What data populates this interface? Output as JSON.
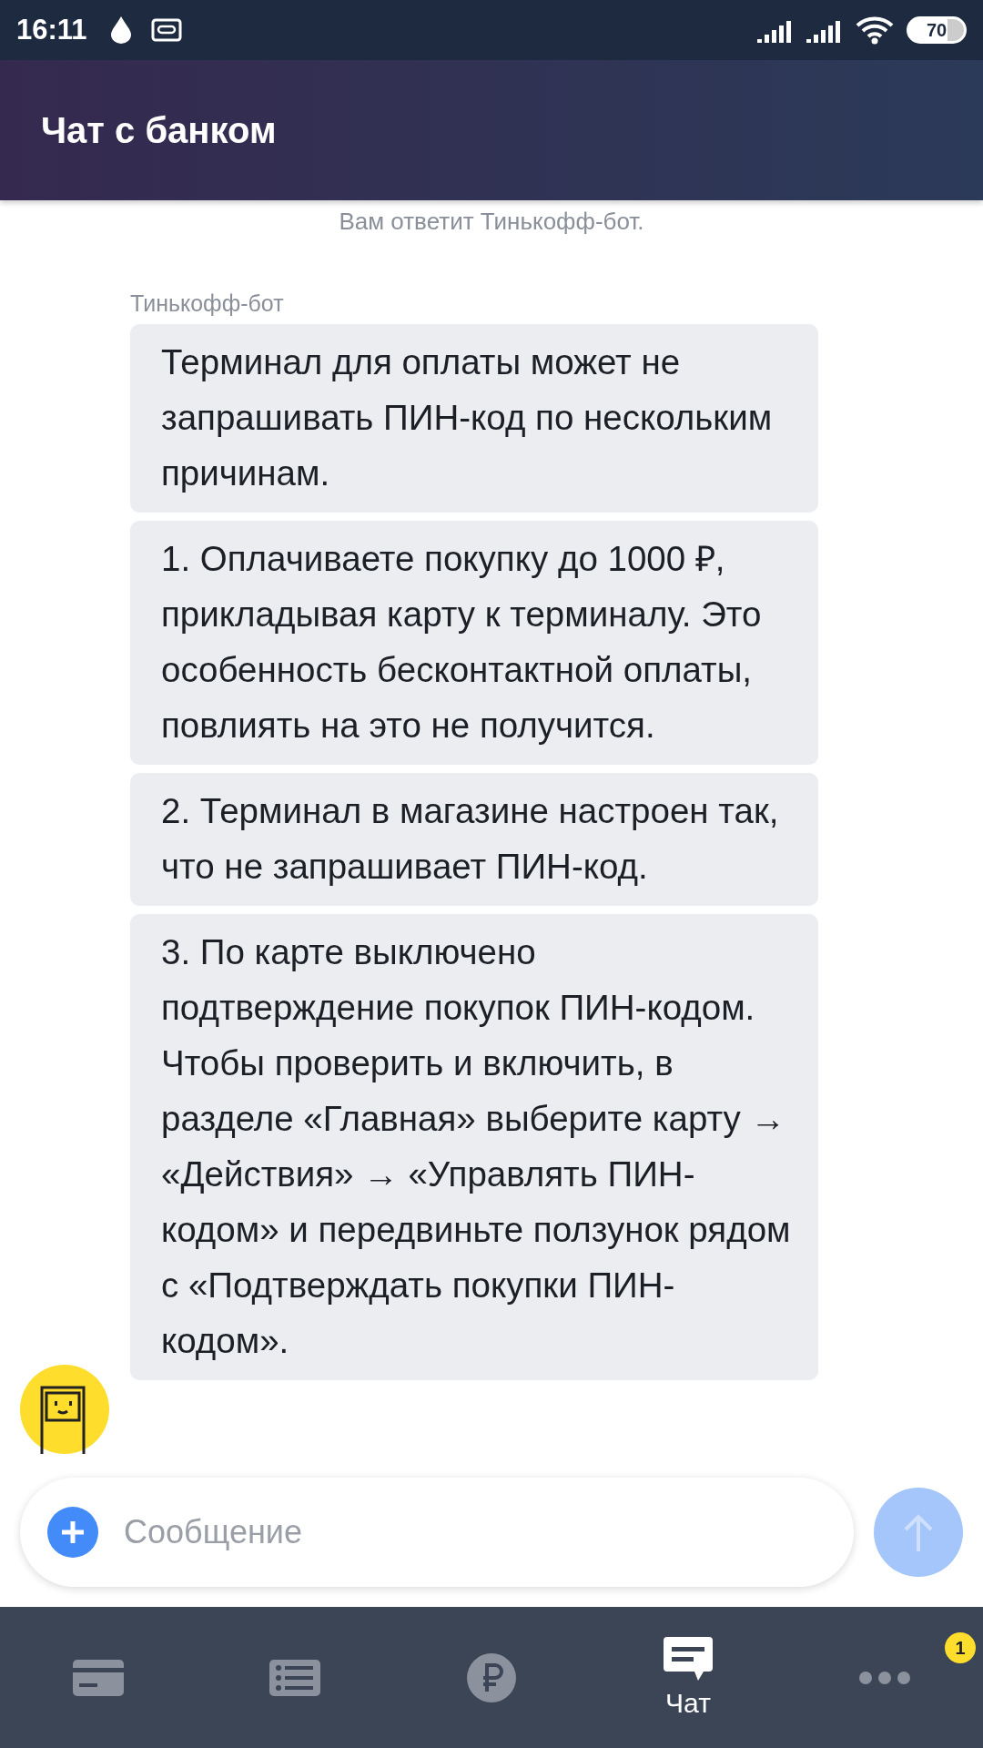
{
  "status_bar": {
    "time": "16:11",
    "battery": "70"
  },
  "header": {
    "title": "Чат с банком"
  },
  "chat": {
    "system_note": "Вам ответит Тинькофф-бот.",
    "sender": "Тинькофф-бот",
    "messages": [
      {
        "text": "Терминал для оплаты может не запрашивать ПИН-код по нескольким причинам."
      },
      {
        "text": "1. Оплачиваете покупку до 1000 ₽, прикладывая карту к терминалу. Это особенность бесконтактной оплаты, повлиять на это не получится."
      },
      {
        "text": "2. Терминал в магазине настроен так, что не запрашивает ПИН-код."
      },
      {
        "text": "3. По карте выключено подтверждение покупок ПИН-кодом. Чтобы проверить и включить, в разделе «Главная» выберите карту → «Действия» → «Управлять ПИН-кодом» и передвиньте ползунок рядом с «Подтверждать покупки ПИН-кодом»."
      }
    ]
  },
  "composer": {
    "placeholder": "Сообщение"
  },
  "bottom_nav": [
    {
      "kind": "card",
      "selected": false
    },
    {
      "kind": "list",
      "selected": false
    },
    {
      "kind": "ruble",
      "selected": false
    },
    {
      "kind": "chat",
      "label": "Чат",
      "selected": true
    },
    {
      "kind": "more",
      "badge": "1",
      "selected": false
    }
  ]
}
